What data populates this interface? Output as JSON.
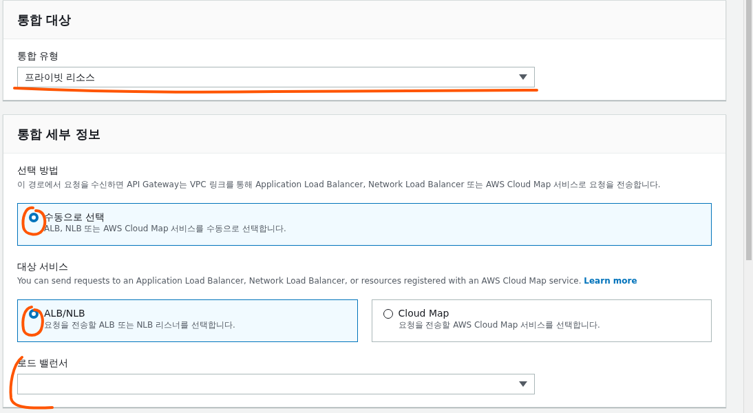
{
  "sections": [
    {
      "title": "통합 대상",
      "fields": [
        {
          "kind": "select",
          "label": "통합 유형",
          "value": "프라이빗 리소스"
        }
      ]
    },
    {
      "title": "통합 세부 정보",
      "fields": [
        {
          "kind": "radio_group",
          "label": "선택 방법",
          "description": "이 경로에서 요청을 수신하면 API Gateway는 VPC 링크를 통해 Application Load Balancer, Network Load Balancer 또는 AWS Cloud Map 서비스로 요청을 전송합니다.",
          "options": [
            {
              "label": "수동으로 선택",
              "description": "ALB, NLB 또는 AWS Cloud Map 서비스를 수동으로 선택합니다.",
              "selected": true
            }
          ]
        },
        {
          "kind": "radio_group",
          "label": "대상 서비스",
          "description": "You can send requests to an Application Load Balancer, Network Load Balancer, or resources registered with an AWS Cloud Map service.",
          "link": "Learn more",
          "options": [
            {
              "label": "ALB/NLB",
              "description": "요청을 전송할 ALB 또는 NLB 리스너를 선택합니다.",
              "selected": true
            },
            {
              "label": "Cloud Map",
              "description": "요청을 전송할 AWS Cloud Map 서비스를 선택합니다.",
              "selected": false
            }
          ]
        },
        {
          "kind": "select",
          "label": "로드 밸런서"
        }
      ]
    }
  ]
}
